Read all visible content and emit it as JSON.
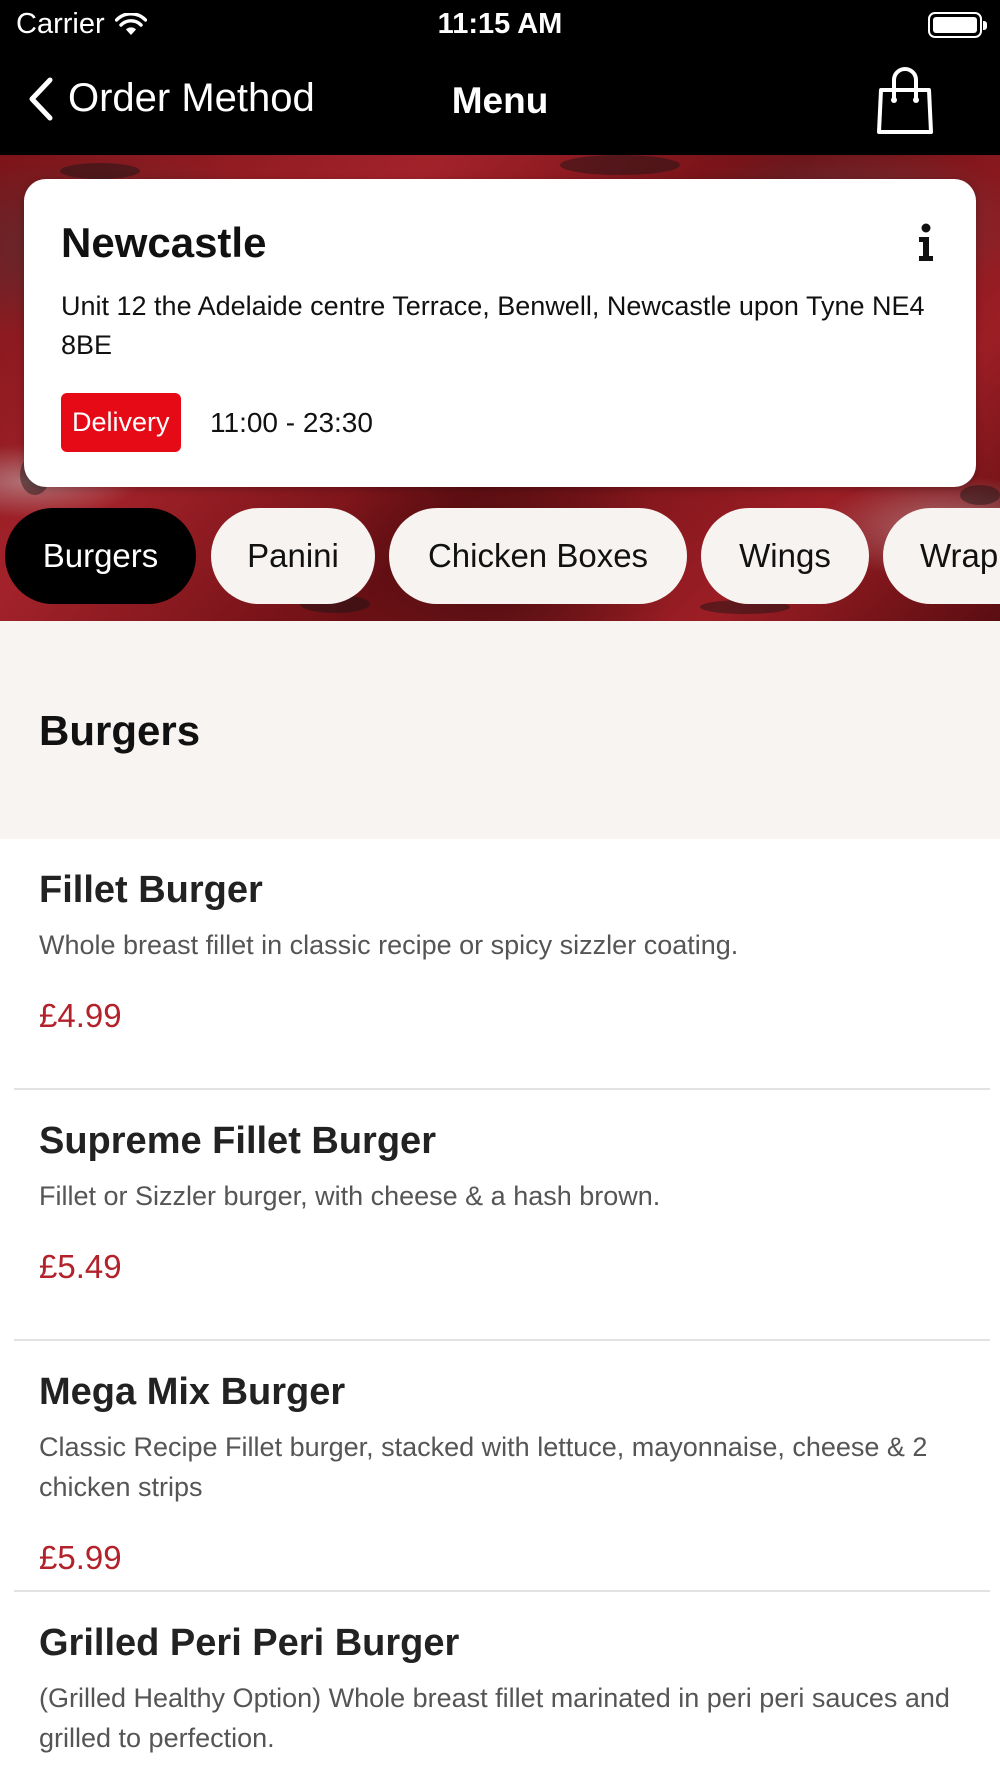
{
  "status_bar": {
    "carrier": "Carrier",
    "time": "11:15 AM"
  },
  "nav": {
    "back_label": "Order Method",
    "title": "Menu"
  },
  "store": {
    "name": "Newcastle",
    "address": "Unit 12 the Adelaide centre Terrace, Benwell, Newcastle upon Tyne NE4 8BE",
    "order_type": "Delivery",
    "hours": "11:00 - 23:30"
  },
  "categories": [
    {
      "label": "Burgers",
      "active": true
    },
    {
      "label": "Panini",
      "active": false
    },
    {
      "label": "Chicken Boxes",
      "active": false
    },
    {
      "label": "Wings",
      "active": false
    },
    {
      "label": "Wrap",
      "active": false
    }
  ],
  "section": {
    "title": "Burgers"
  },
  "items": [
    {
      "name": "Fillet Burger",
      "description": "Whole breast fillet in classic recipe or spicy sizzler coating.",
      "price": "£4.99"
    },
    {
      "name": "Supreme Fillet Burger",
      "description": "Fillet or Sizzler burger, with cheese & a hash brown.",
      "price": "£5.49"
    },
    {
      "name": "Mega Mix Burger",
      "description": "Classic Recipe Fillet burger, stacked with lettuce, mayonnaise, cheese & 2 chicken strips",
      "price": "£5.99"
    },
    {
      "name": "Grilled Peri Peri Burger",
      "description": "(Grilled Healthy Option) Whole breast fillet marinated in peri peri sauces and grilled to perfection.",
      "price": ""
    }
  ],
  "colors": {
    "accent": "#e60a17",
    "price": "#b3222a",
    "bar": "#000000"
  }
}
